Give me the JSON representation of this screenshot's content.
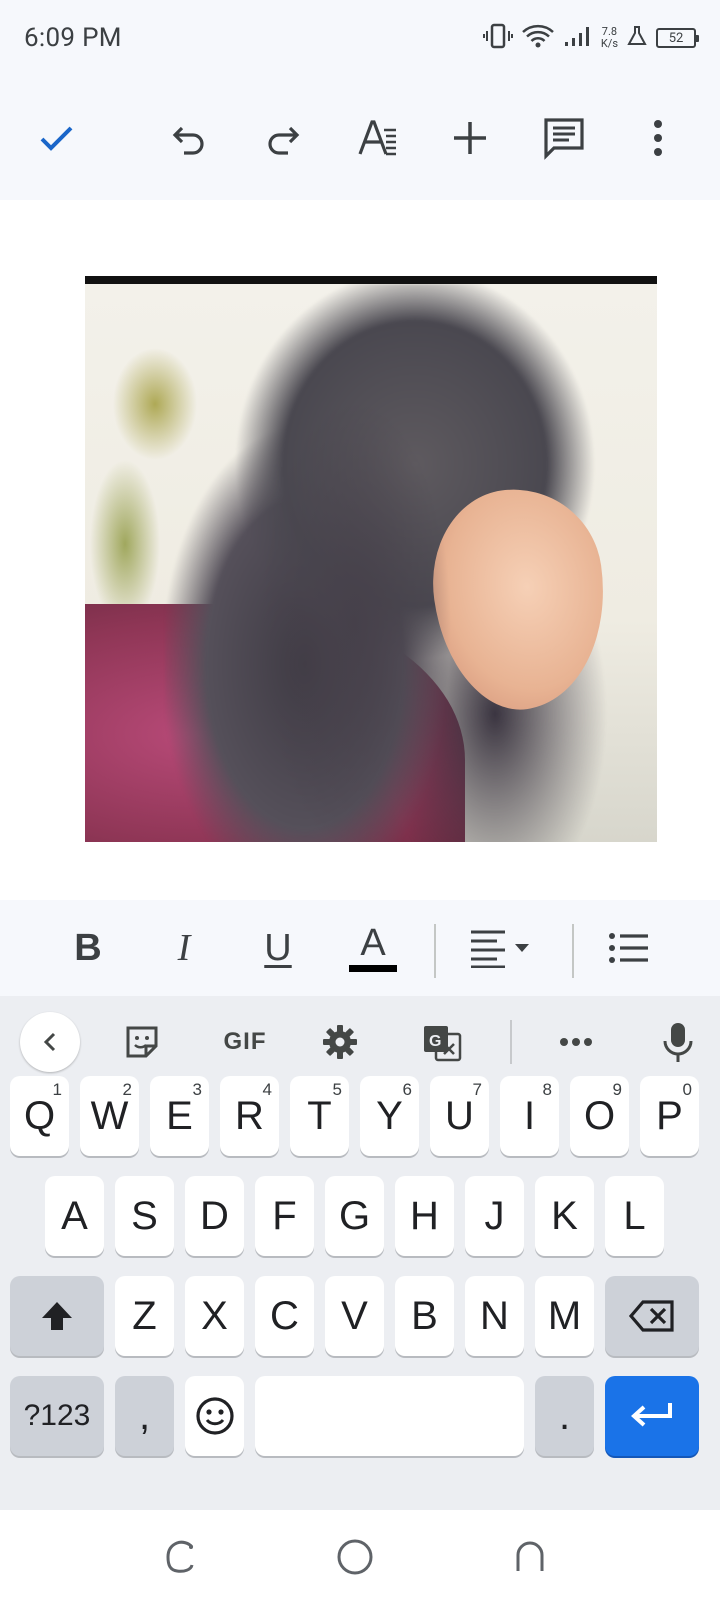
{
  "status_bar": {
    "time": "6:09 PM",
    "net_speed_value": "7.8",
    "net_speed_unit": "K/s",
    "battery": "52"
  },
  "toolbar": {
    "done": "check-icon",
    "undo": "undo-icon",
    "redo": "redo-icon",
    "text_format": "text-format-icon",
    "insert": "plus-icon",
    "comment": "comment-icon",
    "more": "more-vert-icon"
  },
  "document": {
    "image_icon": "photo-image"
  },
  "format_bar": {
    "bold": "B",
    "italic": "I",
    "underline": "U",
    "text_color": "A",
    "text_color_value": "#000000"
  },
  "keyboard": {
    "top_row": {
      "gif_label": "GIF"
    },
    "row1": [
      {
        "key": "Q",
        "hint": "1"
      },
      {
        "key": "W",
        "hint": "2"
      },
      {
        "key": "E",
        "hint": "3"
      },
      {
        "key": "R",
        "hint": "4"
      },
      {
        "key": "T",
        "hint": "5"
      },
      {
        "key": "Y",
        "hint": "6"
      },
      {
        "key": "U",
        "hint": "7"
      },
      {
        "key": "I",
        "hint": "8"
      },
      {
        "key": "O",
        "hint": "9"
      },
      {
        "key": "P",
        "hint": "0"
      }
    ],
    "row2": [
      "A",
      "S",
      "D",
      "F",
      "G",
      "H",
      "J",
      "K",
      "L"
    ],
    "row3": [
      "Z",
      "X",
      "C",
      "V",
      "B",
      "N",
      "M"
    ],
    "symbols_key": "?123",
    "comma_key": ",",
    "period_key": ".",
    "accent_color": "#1a73e8"
  }
}
